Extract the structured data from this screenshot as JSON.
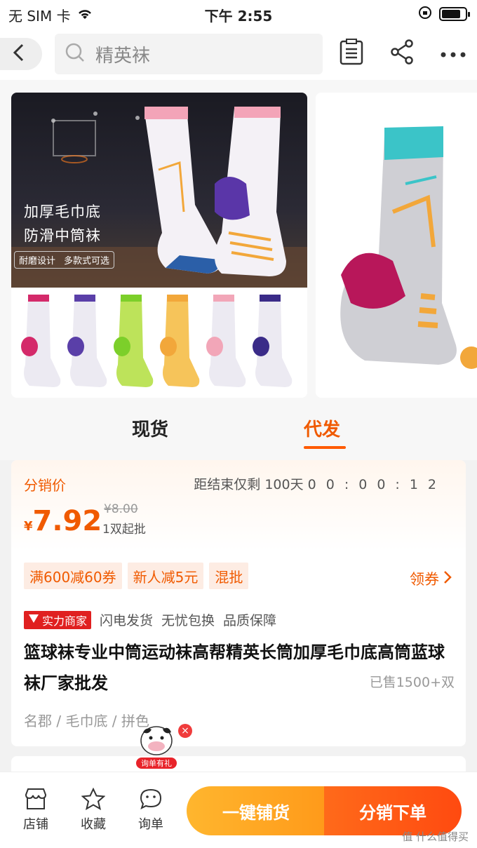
{
  "status_bar": {
    "carrier": "无 SIM 卡",
    "time": "下午 2:55",
    "icons": [
      "wifi-icon",
      "rotation-lock-icon",
      "battery-icon"
    ]
  },
  "header": {
    "search_text": "精英袜",
    "icons": [
      "back-arrow-icon",
      "search-icon",
      "clipboard-icon",
      "share-icon",
      "more-icon"
    ]
  },
  "gallery": {
    "hero_line1": "加厚毛巾底",
    "hero_line2": "防滑中筒袜",
    "hero_tags": [
      "耐磨设计",
      "多款式可选"
    ],
    "variant_colors": [
      "#d42a6a",
      "#5a3fa8",
      "#7ccf2a",
      "#f2a73a",
      "#f2a6b8",
      "#3a2b88"
    ]
  },
  "tabs": [
    {
      "label": "现货",
      "active": false
    },
    {
      "label": "代发",
      "active": true
    }
  ],
  "price": {
    "label": "分销价",
    "countdown_prefix": "距结束仅剩",
    "countdown_days": "100天",
    "countdown_time": "00:00:12",
    "currency": "¥",
    "value": "7.92",
    "original": "¥8.00",
    "min_order": "1双起批"
  },
  "coupons": [
    "满600减60券",
    "新人减5元",
    "混批"
  ],
  "get_coupon_label": "领券",
  "merchant": {
    "badge": "实力商家",
    "services": [
      "闪电发货",
      "无忧包换",
      "品质保障"
    ]
  },
  "product": {
    "title": "篮球袜专业中筒运动袜高帮精英长筒加厚毛巾底高筒蓝球袜厂家批发",
    "sold": "已售1500+双",
    "attributes": "名郡 / 毛巾底 / 拼色"
  },
  "mascot": {
    "label": "询单有礼"
  },
  "bottom_bar": {
    "items": [
      {
        "label": "店铺",
        "icon": "store-icon"
      },
      {
        "label": "收藏",
        "icon": "star-icon"
      },
      {
        "label": "询单",
        "icon": "chat-icon"
      }
    ],
    "primary_left": "一键铺货",
    "primary_right": "分销下单"
  },
  "watermark": "值 什么值得买",
  "colors": {
    "accent": "#f05a00",
    "orange_button": "#ffa826",
    "red_button": "#ff5214"
  }
}
